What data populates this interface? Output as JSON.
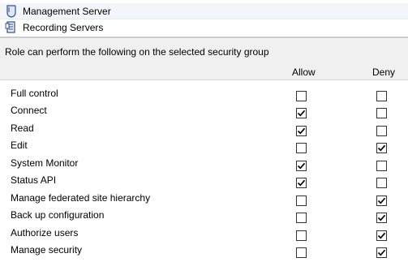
{
  "tree": {
    "items": [
      {
        "label": "Management Server",
        "icon": "server-shield-icon"
      },
      {
        "label": "Recording Servers",
        "icon": "recording-servers-icon"
      }
    ]
  },
  "section": {
    "title": "Role can perform the following on the selected security group"
  },
  "columns": {
    "allow": "Allow",
    "deny": "Deny"
  },
  "permissions": [
    {
      "label": "Full control",
      "allow": false,
      "deny": false
    },
    {
      "label": "Connect",
      "allow": true,
      "deny": false
    },
    {
      "label": "Read",
      "allow": true,
      "deny": false
    },
    {
      "label": "Edit",
      "allow": false,
      "deny": true
    },
    {
      "label": "System Monitor",
      "allow": true,
      "deny": false
    },
    {
      "label": "Status API",
      "allow": true,
      "deny": false
    },
    {
      "label": "Manage federated site hierarchy",
      "allow": false,
      "deny": true
    },
    {
      "label": "Back up configuration",
      "allow": false,
      "deny": true
    },
    {
      "label": "Authorize users",
      "allow": false,
      "deny": true
    },
    {
      "label": "Manage security",
      "allow": false,
      "deny": true
    }
  ]
}
